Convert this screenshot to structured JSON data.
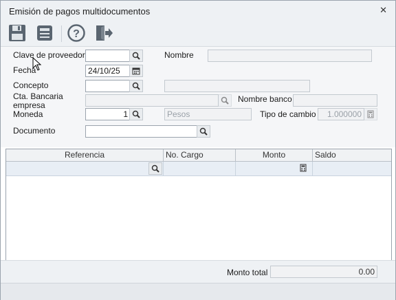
{
  "window": {
    "title": "Emisión de pagos multidocumentos",
    "close_glyph": "✕"
  },
  "toolbar": {
    "icons": [
      "save-icon",
      "print-icon",
      "help-icon",
      "exit-icon"
    ]
  },
  "form": {
    "proveedor_label": "Clave de proveedor",
    "proveedor_value": "",
    "nombre_label": "Nombre",
    "nombre_value": "",
    "fecha_label": "Fecha",
    "fecha_value": "24/10/25",
    "concepto_label": "Concepto",
    "concepto_value": "",
    "concepto_desc": "",
    "cta_label_1": "Cta. Bancaria",
    "cta_label_2": "empresa",
    "cta_value": "",
    "banco_label": "Nombre banco",
    "banco_value": "",
    "moneda_label": "Moneda",
    "moneda_value": "1",
    "moneda_desc": "Pesos",
    "tipo_cambio_label": "Tipo de cambio",
    "tipo_cambio_value": "1.000000",
    "documento_label": "Documento",
    "documento_value": ""
  },
  "grid": {
    "columns": [
      "Referencia",
      "No. Cargo",
      "Monto",
      "Saldo"
    ]
  },
  "footer": {
    "total_label": "Monto total",
    "total_value": "0.00"
  },
  "colors": {
    "accent": "#2b4e7a",
    "icon_gray": "#4a5560"
  }
}
